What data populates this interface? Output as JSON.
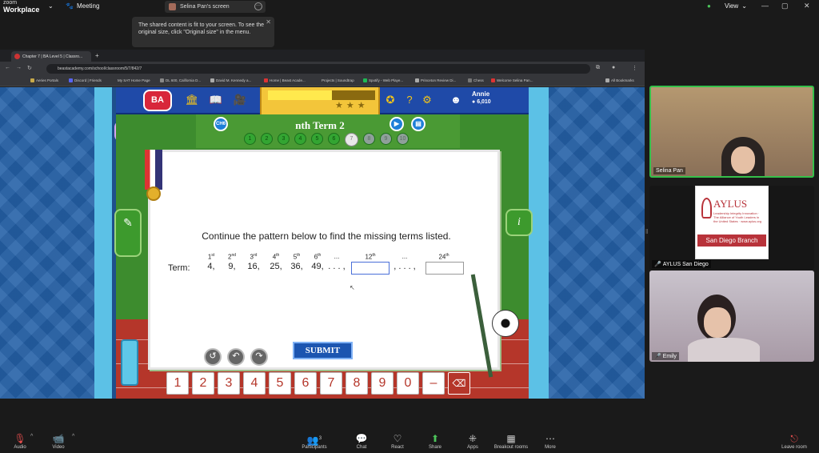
{
  "zoom": {
    "brand_top": "zoom",
    "brand_bottom": "Workplace",
    "meeting_label": "Meeting",
    "share_label": "Selina Pan's screen",
    "tooltip": "The shared content is fit to your screen. To see the original size, click \"Original size\" in the menu.",
    "view_label": "View",
    "toolbar": {
      "audio": "Audio",
      "video": "Video",
      "participants": "Participants",
      "participants_count": "3",
      "chat": "Chat",
      "react": "React",
      "share": "Share",
      "apps": "Apps",
      "breakout": "Breakout rooms",
      "more": "More",
      "leave": "Leave room"
    }
  },
  "browser": {
    "tab_title": "Chapter 7 | BA Level 5 | Classro...",
    "url": "beastacademy.com/school/classroom/5/7/842/7",
    "bookmarks": [
      "Aeries Portals",
      "Discord | Friends",
      "My SAT Home Page",
      "DL 600, California D...",
      "David M. Kennedy a...",
      "Home | Beast Acade...",
      "Projects | Soundtrap",
      "Spotify - Web Playe...",
      "Princeton Review Di...",
      "Chess",
      "Welcome Selina Pan..."
    ],
    "all_bookmarks": "All Bookmarks"
  },
  "game": {
    "logo": "BA",
    "user_name": "Annie",
    "coins": "6,010",
    "chip_left": "CH6",
    "lesson_title": "nth Term 2",
    "progress_dots": [
      "1",
      "2",
      "3",
      "4",
      "5",
      "6",
      "7",
      "8",
      "9",
      "10"
    ],
    "current_problem": 7,
    "question": "Continue the pattern below to find the missing terms listed.",
    "term_label": "Term:",
    "terms": [
      {
        "n": "1",
        "sup": "st",
        "value": "4,"
      },
      {
        "n": "2",
        "sup": "nd",
        "value": "9,"
      },
      {
        "n": "3",
        "sup": "rd",
        "value": "16,"
      },
      {
        "n": "4",
        "sup": "th",
        "value": "25,"
      },
      {
        "n": "5",
        "sup": "th",
        "value": "36,"
      },
      {
        "n": "6",
        "sup": "th",
        "value": "49,"
      },
      {
        "n": "",
        "sup": "",
        "ord_text": "...",
        "value": ". . . ,"
      },
      {
        "n": "12",
        "sup": "th",
        "value": ""
      },
      {
        "n": "",
        "sup": "",
        "ord_text": "...",
        "value": ", . . . ,"
      },
      {
        "n": "24",
        "sup": "th",
        "value": ""
      }
    ],
    "submit": "SUBMIT",
    "keypad": [
      "1",
      "2",
      "3",
      "4",
      "5",
      "6",
      "7",
      "8",
      "9",
      "0",
      "–",
      "⌫"
    ]
  },
  "participants": [
    {
      "name": "Selina Pan"
    },
    {
      "name": "AYLUS San Diego",
      "card_title": "AYLUS",
      "card_sub": "Leadership Integrity Innovation · The Alliance of Youth Leaders in the United States · www.aylus.org",
      "card_branch": "San Diego Branch"
    },
    {
      "name": "Emily"
    }
  ],
  "colors": {
    "page_blue": "#2460a7",
    "game_green": "#3d8c2e",
    "track_red": "#b5362a",
    "submit_blue": "#1c55b0",
    "aylus_red": "#b8333a"
  }
}
